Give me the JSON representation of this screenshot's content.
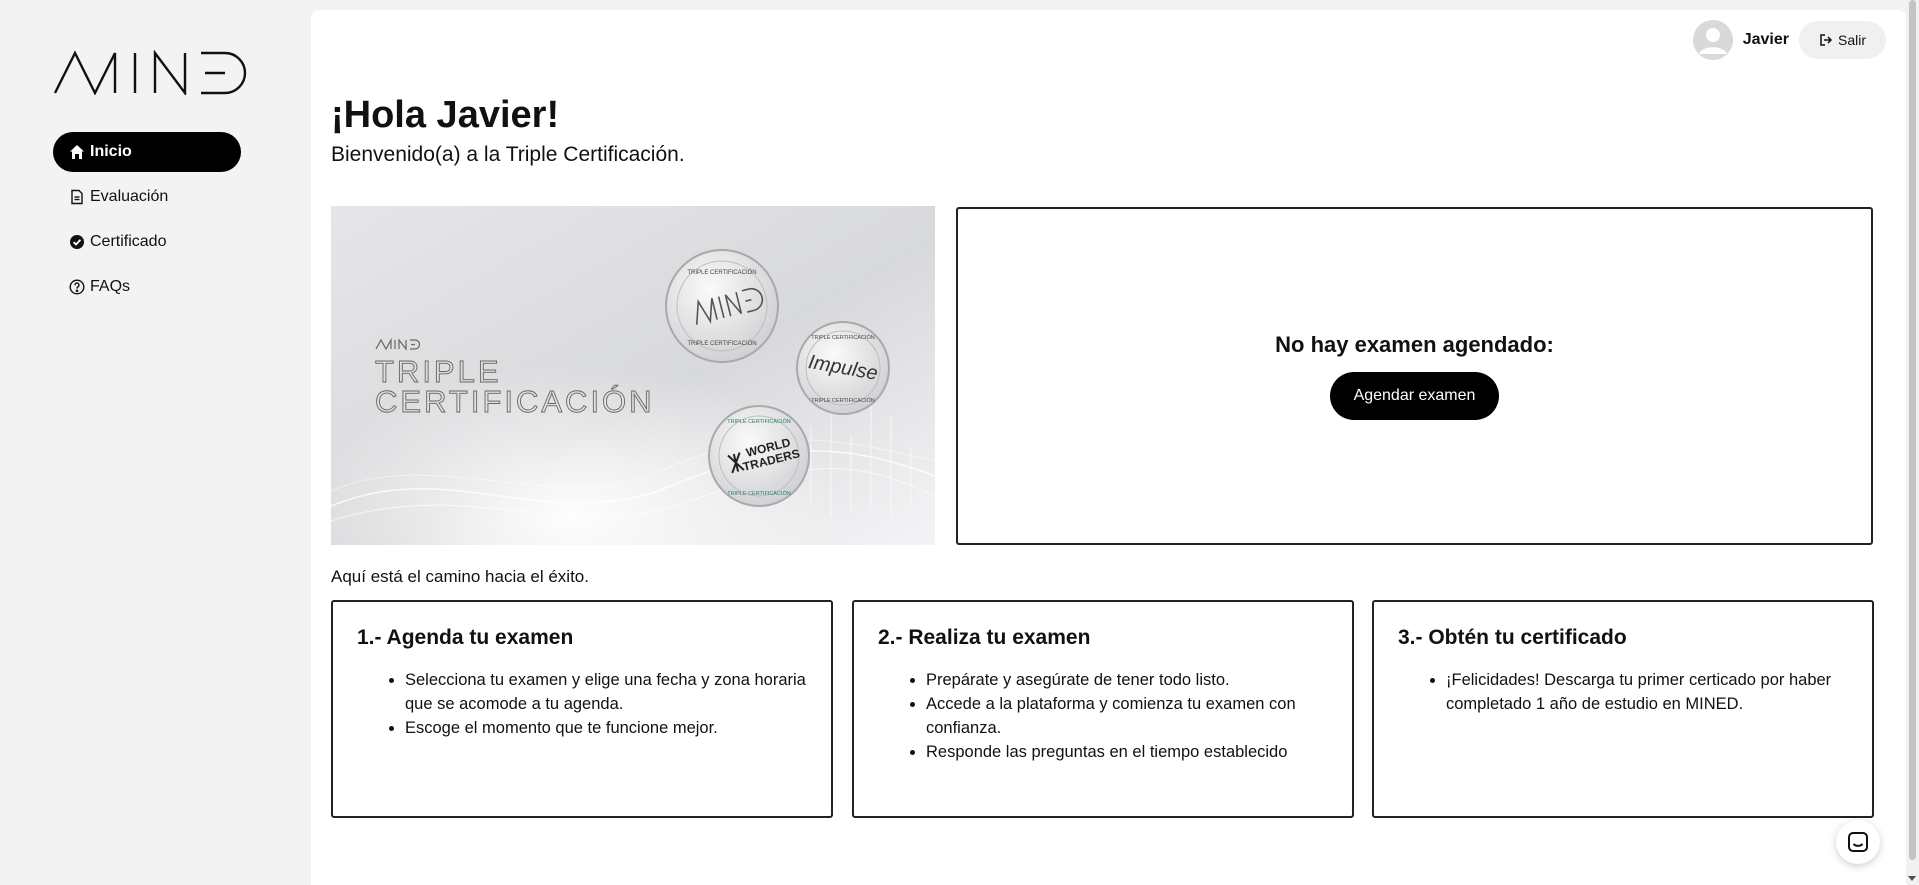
{
  "brand": {
    "logo_text": "MINED"
  },
  "sidebar": {
    "items": [
      {
        "label": "Inicio",
        "icon": "home-icon",
        "active": true
      },
      {
        "label": "Evaluación",
        "icon": "document-icon",
        "active": false
      },
      {
        "label": "Certificado",
        "icon": "check-circle-icon",
        "active": false
      },
      {
        "label": "FAQs",
        "icon": "question-circle-icon",
        "active": false
      }
    ]
  },
  "header": {
    "user_name": "Javier",
    "logout_label": "Salir"
  },
  "main": {
    "greeting": "¡Hola Javier!",
    "subtitle": "Bienvenido(a) a la Triple Certificación.",
    "banner": {
      "brand": "MINED",
      "title_line1": "TRIPLE",
      "title_line2": "CERTIFICACIÓN",
      "seal_top": "TRIPLE CERTIFICACIÓN",
      "seals": [
        "MINED",
        "Impulse",
        "WORLD TRADERS"
      ]
    },
    "exam": {
      "title": "No hay examen agendado:",
      "button_label": "Agendar examen"
    },
    "path_intro": "Aquí está el camino hacia el éxito.",
    "steps": [
      {
        "title": "1.- Agenda tu examen",
        "items": [
          "Selecciona tu examen y elige una fecha y zona horaria que se acomode a tu agenda.",
          "Escoge el momento que te funcione mejor."
        ]
      },
      {
        "title": "2.- Realiza tu examen",
        "items": [
          "Prepárate y asegúrate de tener todo listo.",
          "Accede a la plataforma y comienza tu examen con confianza.",
          "Responde las preguntas en el tiempo establecido"
        ]
      },
      {
        "title": "3.- Obtén tu certificado",
        "items": [
          "¡Felicidades! Descarga tu primer certicado por haber completado 1 año de estudio en MINED."
        ]
      }
    ]
  },
  "colors": {
    "accent": "#000000",
    "background": "#f3f3f3",
    "panel": "#ffffff"
  }
}
